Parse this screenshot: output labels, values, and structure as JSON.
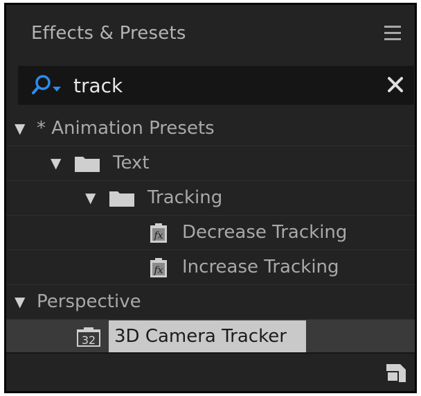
{
  "panel": {
    "title": "Effects & Presets",
    "menu_icon": "hamburger-menu-icon"
  },
  "search": {
    "value": "track",
    "search_icon": "search-dropdown-icon",
    "clear_icon": "close-icon"
  },
  "tree": {
    "items": [
      {
        "label": "* Animation Presets",
        "icon": "disclosure-triangle-icon",
        "expanded": true
      },
      {
        "label": "Text",
        "icon": "folder-icon",
        "expanded": true
      },
      {
        "label": "Tracking",
        "icon": "folder-icon",
        "expanded": true
      },
      {
        "label": "Decrease Tracking",
        "icon": "animation-preset-icon"
      },
      {
        "label": "Increase Tracking",
        "icon": "animation-preset-icon"
      },
      {
        "label": "Perspective",
        "icon": "disclosure-triangle-icon",
        "expanded": true
      },
      {
        "label": "3D Camera Tracker",
        "icon": "effect-32bit-icon",
        "badge": "32",
        "selected": true
      }
    ]
  },
  "footer": {
    "new_preset_icon": "new-item-corner-icon"
  },
  "colors": {
    "panel_bg": "#232323",
    "search_bg": "#151515",
    "search_icon_blue": "#2d8ceb",
    "selected_bg": "#c9c9c9",
    "text": "#a9a9a9"
  }
}
